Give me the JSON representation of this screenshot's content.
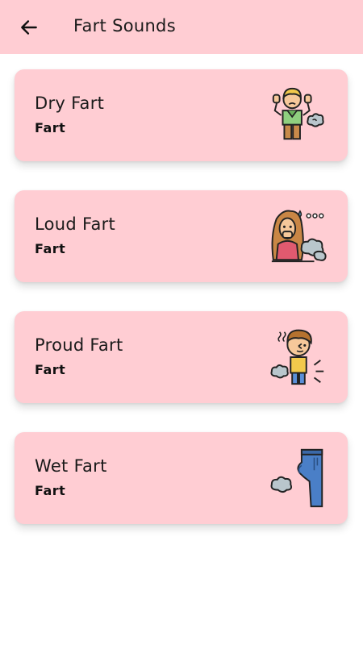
{
  "appbar": {
    "title": "Fart Sounds",
    "back_icon": "arrow-left-icon"
  },
  "sounds": [
    {
      "title": "Dry Fart",
      "subtitle": "Fart",
      "icon": "man-farting-icon"
    },
    {
      "title": "Loud Fart",
      "subtitle": "Fart",
      "icon": "woman-farting-icon"
    },
    {
      "title": "Proud Fart",
      "subtitle": "Fart",
      "icon": "boy-farting-icon"
    },
    {
      "title": "Wet Fart",
      "subtitle": "Fart",
      "icon": "jeans-farting-icon"
    }
  ],
  "colors": {
    "primary": "#ffcdd3",
    "text": "#1a1a1a"
  }
}
